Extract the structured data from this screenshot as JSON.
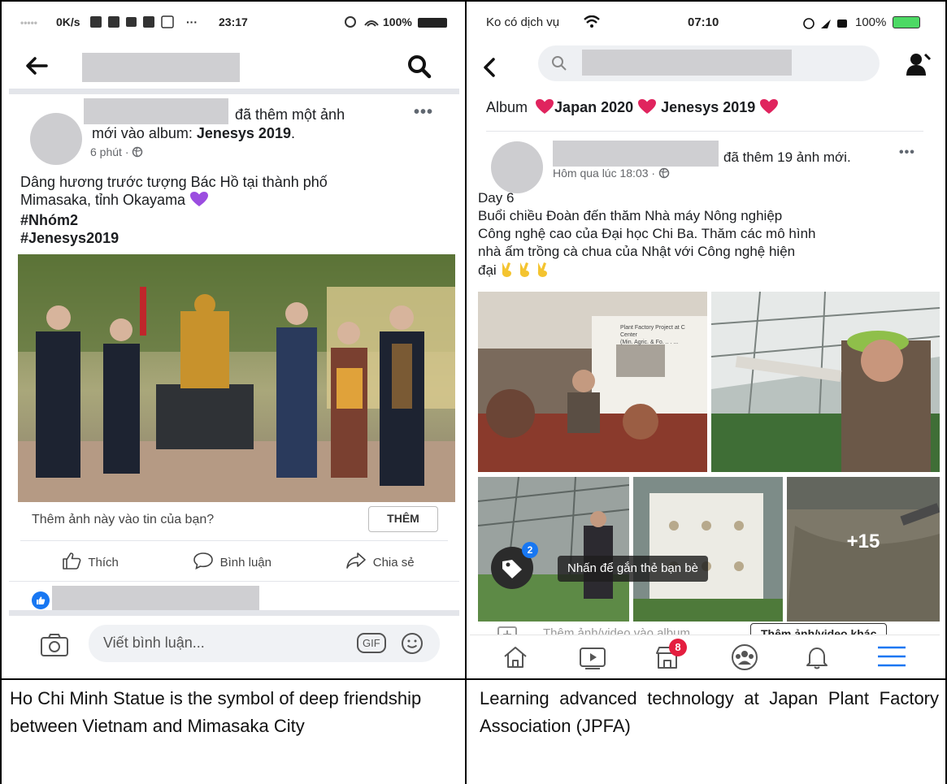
{
  "left_phone": {
    "status": {
      "signal": "•••••",
      "net_speed": "0K/s",
      "dots": "···",
      "time": "23:17",
      "battery": "100%"
    },
    "post": {
      "action_text": "đã thêm một ảnh",
      "album_prefix": "mới vào album: ",
      "album_name": "Jenesys 2019",
      "album_suffix": ".",
      "time": "6 phút ·",
      "caption_line1": "Dâng hương trước tượng Bác Hồ tại thành phố",
      "caption_line2": "Mimasaka, tỉnh Okayama",
      "hashtag1": "#Nhóm2",
      "hashtag2": "#Jenesys2019"
    },
    "story_prompt": "Thêm ảnh này vào tin của bạn?",
    "story_button": "THÊM",
    "actions": {
      "like": "Thích",
      "comment": "Bình luận",
      "share": "Chia sẻ"
    },
    "comment_placeholder": "Viết bình luận...",
    "gif_label": "GIF"
  },
  "right_phone": {
    "status": {
      "carrier": "Ko có dịch vụ",
      "time": "07:10",
      "battery": "100%"
    },
    "album_label": "Album",
    "album_title_1": "Japan 2020",
    "album_title_2": "Jenesys 2019",
    "post": {
      "action_text": "đã thêm 19 ảnh mới.",
      "time": "Hôm qua lúc 18:03 ·",
      "caption_day": "Day 6",
      "caption_line1": "Buổi chiều Đoàn đến thăm Nhà máy Nông nghiệp",
      "caption_line2": "Công nghệ cao của Đại học Chi Ba. Thăm các mô hình",
      "caption_line3": "nhà ấm trồng cà chua của Nhật với Công nghệ hiện",
      "caption_line4": "đại"
    },
    "photo_slide_title": "Plant Factory Project at C\nCenter\n(Min. Agric. & Fo. .. . ...",
    "more_photos": "+15",
    "tag_badge": "2",
    "tag_tooltip": "Nhấn để gắn thẻ bạn bè",
    "add_to_album": "Thêm ảnh/video vào album",
    "add_more_button": "Thêm ảnh/video khác",
    "marketplace_badge": "8"
  },
  "captions": {
    "left": "Ho Chi Minh Statue is the symbol of deep friendship between Vietnam and Mimasaka City",
    "right": "Learning advanced technology at Japan Plant Factory Association (JPFA)"
  },
  "colors": {
    "facebook_blue": "#1877f2",
    "heart_red": "#e0245e",
    "purple_heart": "#9b4de0",
    "badge_red": "#e41e3f"
  }
}
